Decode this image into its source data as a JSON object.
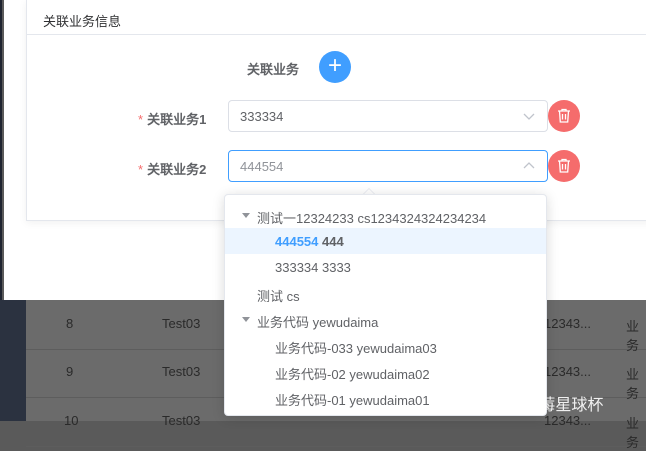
{
  "card": {
    "title": "关联业务信息"
  },
  "form": {
    "add_label": "关联业务",
    "add_button_symbol": "+",
    "required_mark": "*",
    "fields": [
      {
        "label": "关联业务1",
        "value": "333334"
      },
      {
        "label": "关联业务2",
        "placeholder": "444554"
      }
    ]
  },
  "dropdown": {
    "nodes": [
      {
        "text": "测试一12324233 cs1234324324234234",
        "expanded": true
      },
      {
        "code": "444554",
        "name": "444",
        "selected": true
      },
      {
        "text": "333334 3333"
      },
      {
        "text": "测试 cs"
      },
      {
        "text": "业务代码 yewudaima",
        "expanded": true
      },
      {
        "text": "业务代码-033 yewudaima03"
      },
      {
        "text": "业务代码-02 yewudaima02"
      },
      {
        "text": "业务代码-01 yewudaima01"
      }
    ]
  },
  "background_table": {
    "rows": [
      {
        "num": "8",
        "name": "Test03",
        "col4": "12343...",
        "col5": "业务"
      },
      {
        "num": "9",
        "name": "Test03",
        "col4": "12343...",
        "col5": "业务"
      },
      {
        "num": "10",
        "name": "Test03",
        "col4": "12343...",
        "col5": "业务"
      }
    ]
  },
  "watermark": "CSDN @-草莓星球杯",
  "colors": {
    "primary": "#409eff",
    "danger": "#f56c6c",
    "selected_bg": "#ecf5ff"
  }
}
